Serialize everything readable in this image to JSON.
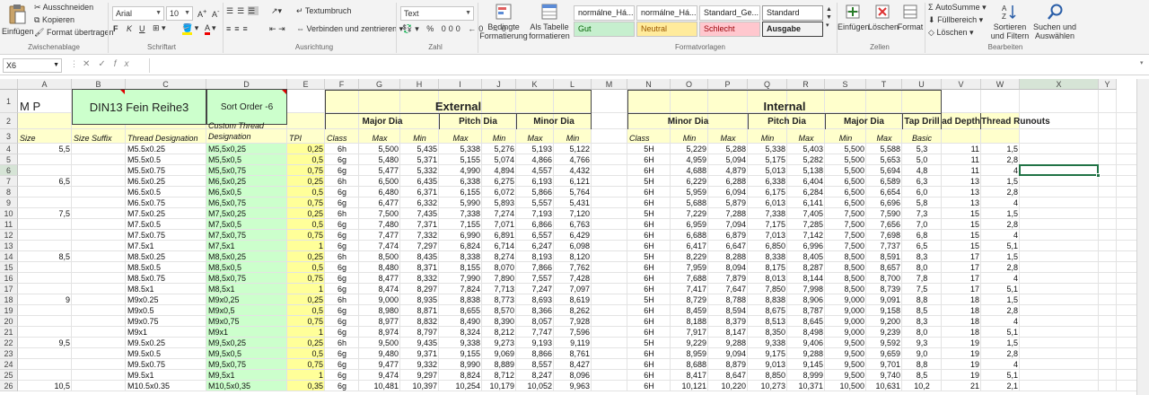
{
  "ribbon": {
    "clipboard": {
      "paste": "Einfügen",
      "cut": "Ausschneiden",
      "copy": "Kopieren",
      "format_painter": "Format übertragen",
      "group": "Zwischenablage"
    },
    "font": {
      "name": "Arial",
      "size": "10",
      "group": "Schriftart",
      "bold": "F",
      "italic": "K",
      "underline": "U"
    },
    "alignment": {
      "wrap": "Textumbruch",
      "merge": "Verbinden und zentrieren",
      "group": "Ausrichtung"
    },
    "number": {
      "format": "Text",
      "group": "Zahl"
    },
    "styles": {
      "conditional": "Bedingte Formatierung",
      "as_table": "Als Tabelle formatieren",
      "group": "Formatvorlagen",
      "cells": [
        "normálne_Há...",
        "normálne_Há...",
        "Standard_Ge...",
        "Standard",
        "Gut",
        "Neutral",
        "Schlecht",
        "Ausgabe"
      ]
    },
    "cells": {
      "insert": "Einfügen",
      "delete": "Löschen",
      "format": "Format",
      "group": "Zellen"
    },
    "editing": {
      "autosum": "AutoSumme",
      "fill": "Füllbereich",
      "clear": "Löschen",
      "sort": "Sortieren und Filtern",
      "find": "Suchen und Auswählen",
      "group": "Bearbeiten"
    }
  },
  "formula_bar": {
    "name_box": "X6",
    "content": ""
  },
  "columns": [
    "A",
    "B",
    "C",
    "D",
    "E",
    "F",
    "G",
    "H",
    "I",
    "J",
    "K",
    "L",
    "M",
    "N",
    "O",
    "P",
    "Q",
    "R",
    "S",
    "T",
    "U",
    "V",
    "W",
    "X",
    "Y"
  ],
  "header": {
    "mp": "M P",
    "title": "DIN13 Fein Reihe3",
    "sort": "Sort Order -6",
    "external": "External",
    "internal": "Internal",
    "major_dia": "Major Dia",
    "pitch_dia": "Pitch Dia",
    "minor_dia": "Minor Dia",
    "tap_drill": "Tap Drill",
    "thread_depth": "Thread Depth",
    "thread_runouts": "Thread Runouts",
    "custom": "Custom Thread Designation",
    "size": "Size",
    "size_suffix": "Size Suffix",
    "designation": "Thread Designation",
    "tpi": "TPI",
    "class": "Class",
    "max": "Max",
    "min": "Min",
    "basic": "Basic"
  },
  "rows": [
    {
      "n": "4",
      "a": "5,5",
      "c": "M5.5x0.25",
      "d": "M5,5x0,25",
      "e": "0,25",
      "f": "6h",
      "g": "5,500",
      "h": "5,435",
      "i": "5,338",
      "j": "5,276",
      "k": "5,193",
      "l": "5,122",
      "n2": "5H",
      "o": "5,229",
      "p": "5,288",
      "q": "5,338",
      "r": "5,403",
      "s": "5,500",
      "t": "5,588",
      "u": "5,3",
      "v": "11",
      "w": "1,5"
    },
    {
      "n": "5",
      "a": "",
      "c": "M5.5x0.5",
      "d": "M5,5x0,5",
      "e": "0,5",
      "f": "6g",
      "g": "5,480",
      "h": "5,371",
      "i": "5,155",
      "j": "5,074",
      "k": "4,866",
      "l": "4,766",
      "n2": "6H",
      "o": "4,959",
      "p": "5,094",
      "q": "5,175",
      "r": "5,282",
      "s": "5,500",
      "t": "5,653",
      "u": "5,0",
      "v": "11",
      "w": "2,8"
    },
    {
      "n": "6",
      "a": "",
      "c": "M5.5x0.75",
      "d": "M5,5x0,75",
      "e": "0,75",
      "f": "6g",
      "g": "5,477",
      "h": "5,332",
      "i": "4,990",
      "j": "4,894",
      "k": "4,557",
      "l": "4,432",
      "n2": "6H",
      "o": "4,688",
      "p": "4,879",
      "q": "5,013",
      "r": "5,138",
      "s": "5,500",
      "t": "5,694",
      "u": "4,8",
      "v": "11",
      "w": "4"
    },
    {
      "n": "7",
      "a": "6,5",
      "c": "M6.5x0.25",
      "d": "M6,5x0,25",
      "e": "0,25",
      "f": "6h",
      "g": "6,500",
      "h": "6,435",
      "i": "6,338",
      "j": "6,275",
      "k": "6,193",
      "l": "6,121",
      "n2": "5H",
      "o": "6,229",
      "p": "6,288",
      "q": "6,338",
      "r": "6,404",
      "s": "6,500",
      "t": "6,589",
      "u": "6,3",
      "v": "13",
      "w": "1,5"
    },
    {
      "n": "8",
      "a": "",
      "c": "M6.5x0.5",
      "d": "M6,5x0,5",
      "e": "0,5",
      "f": "6g",
      "g": "6,480",
      "h": "6,371",
      "i": "6,155",
      "j": "6,072",
      "k": "5,866",
      "l": "5,764",
      "n2": "6H",
      "o": "5,959",
      "p": "6,094",
      "q": "6,175",
      "r": "6,284",
      "s": "6,500",
      "t": "6,654",
      "u": "6,0",
      "v": "13",
      "w": "2,8"
    },
    {
      "n": "9",
      "a": "",
      "c": "M6.5x0.75",
      "d": "M6,5x0,75",
      "e": "0,75",
      "f": "6g",
      "g": "6,477",
      "h": "6,332",
      "i": "5,990",
      "j": "5,893",
      "k": "5,557",
      "l": "5,431",
      "n2": "6H",
      "o": "5,688",
      "p": "5,879",
      "q": "6,013",
      "r": "6,141",
      "s": "6,500",
      "t": "6,696",
      "u": "5,8",
      "v": "13",
      "w": "4"
    },
    {
      "n": "10",
      "a": "7,5",
      "c": "M7.5x0.25",
      "d": "M7,5x0,25",
      "e": "0,25",
      "f": "6h",
      "g": "7,500",
      "h": "7,435",
      "i": "7,338",
      "j": "7,274",
      "k": "7,193",
      "l": "7,120",
      "n2": "5H",
      "o": "7,229",
      "p": "7,288",
      "q": "7,338",
      "r": "7,405",
      "s": "7,500",
      "t": "7,590",
      "u": "7,3",
      "v": "15",
      "w": "1,5"
    },
    {
      "n": "11",
      "a": "",
      "c": "M7.5x0.5",
      "d": "M7,5x0,5",
      "e": "0,5",
      "f": "6g",
      "g": "7,480",
      "h": "7,371",
      "i": "7,155",
      "j": "7,071",
      "k": "6,866",
      "l": "6,763",
      "n2": "6H",
      "o": "6,959",
      "p": "7,094",
      "q": "7,175",
      "r": "7,285",
      "s": "7,500",
      "t": "7,656",
      "u": "7,0",
      "v": "15",
      "w": "2,8"
    },
    {
      "n": "12",
      "a": "",
      "c": "M7.5x0.75",
      "d": "M7,5x0,75",
      "e": "0,75",
      "f": "6g",
      "g": "7,477",
      "h": "7,332",
      "i": "6,990",
      "j": "6,891",
      "k": "6,557",
      "l": "6,429",
      "n2": "6H",
      "o": "6,688",
      "p": "6,879",
      "q": "7,013",
      "r": "7,142",
      "s": "7,500",
      "t": "7,698",
      "u": "6,8",
      "v": "15",
      "w": "4"
    },
    {
      "n": "13",
      "a": "",
      "c": "M7.5x1",
      "d": "M7,5x1",
      "e": "1",
      "f": "6g",
      "g": "7,474",
      "h": "7,297",
      "i": "6,824",
      "j": "6,714",
      "k": "6,247",
      "l": "6,098",
      "n2": "6H",
      "o": "6,417",
      "p": "6,647",
      "q": "6,850",
      "r": "6,996",
      "s": "7,500",
      "t": "7,737",
      "u": "6,5",
      "v": "15",
      "w": "5,1"
    },
    {
      "n": "14",
      "a": "8,5",
      "c": "M8.5x0.25",
      "d": "M8,5x0,25",
      "e": "0,25",
      "f": "6h",
      "g": "8,500",
      "h": "8,435",
      "i": "8,338",
      "j": "8,274",
      "k": "8,193",
      "l": "8,120",
      "n2": "5H",
      "o": "8,229",
      "p": "8,288",
      "q": "8,338",
      "r": "8,405",
      "s": "8,500",
      "t": "8,591",
      "u": "8,3",
      "v": "17",
      "w": "1,5"
    },
    {
      "n": "15",
      "a": "",
      "c": "M8.5x0.5",
      "d": "M8,5x0,5",
      "e": "0,5",
      "f": "6g",
      "g": "8,480",
      "h": "8,371",
      "i": "8,155",
      "j": "8,070",
      "k": "7,866",
      "l": "7,762",
      "n2": "6H",
      "o": "7,959",
      "p": "8,094",
      "q": "8,175",
      "r": "8,287",
      "s": "8,500",
      "t": "8,657",
      "u": "8,0",
      "v": "17",
      "w": "2,8"
    },
    {
      "n": "16",
      "a": "",
      "c": "M8.5x0.75",
      "d": "M8,5x0,75",
      "e": "0,75",
      "f": "6g",
      "g": "8,477",
      "h": "8,332",
      "i": "7,990",
      "j": "7,890",
      "k": "7,557",
      "l": "7,428",
      "n2": "6H",
      "o": "7,688",
      "p": "7,879",
      "q": "8,013",
      "r": "8,144",
      "s": "8,500",
      "t": "8,700",
      "u": "7,8",
      "v": "17",
      "w": "4"
    },
    {
      "n": "17",
      "a": "",
      "c": "M8.5x1",
      "d": "M8,5x1",
      "e": "1",
      "f": "6g",
      "g": "8,474",
      "h": "8,297",
      "i": "7,824",
      "j": "7,713",
      "k": "7,247",
      "l": "7,097",
      "n2": "6H",
      "o": "7,417",
      "p": "7,647",
      "q": "7,850",
      "r": "7,998",
      "s": "8,500",
      "t": "8,739",
      "u": "7,5",
      "v": "17",
      "w": "5,1"
    },
    {
      "n": "18",
      "a": "9",
      "c": "M9x0.25",
      "d": "M9x0,25",
      "e": "0,25",
      "f": "6h",
      "g": "9,000",
      "h": "8,935",
      "i": "8,838",
      "j": "8,773",
      "k": "8,693",
      "l": "8,619",
      "n2": "5H",
      "o": "8,729",
      "p": "8,788",
      "q": "8,838",
      "r": "8,906",
      "s": "9,000",
      "t": "9,091",
      "u": "8,8",
      "v": "18",
      "w": "1,5"
    },
    {
      "n": "19",
      "a": "",
      "c": "M9x0.5",
      "d": "M9x0,5",
      "e": "0,5",
      "f": "6g",
      "g": "8,980",
      "h": "8,871",
      "i": "8,655",
      "j": "8,570",
      "k": "8,366",
      "l": "8,262",
      "n2": "6H",
      "o": "8,459",
      "p": "8,594",
      "q": "8,675",
      "r": "8,787",
      "s": "9,000",
      "t": "9,158",
      "u": "8,5",
      "v": "18",
      "w": "2,8"
    },
    {
      "n": "20",
      "a": "",
      "c": "M9x0.75",
      "d": "M9x0,75",
      "e": "0,75",
      "f": "6g",
      "g": "8,977",
      "h": "8,832",
      "i": "8,490",
      "j": "8,390",
      "k": "8,057",
      "l": "7,928",
      "n2": "6H",
      "o": "8,188",
      "p": "8,379",
      "q": "8,513",
      "r": "8,645",
      "s": "9,000",
      "t": "9,200",
      "u": "8,3",
      "v": "18",
      "w": "4"
    },
    {
      "n": "21",
      "a": "",
      "c": "M9x1",
      "d": "M9x1",
      "e": "1",
      "f": "6g",
      "g": "8,974",
      "h": "8,797",
      "i": "8,324",
      "j": "8,212",
      "k": "7,747",
      "l": "7,596",
      "n2": "6H",
      "o": "7,917",
      "p": "8,147",
      "q": "8,350",
      "r": "8,498",
      "s": "9,000",
      "t": "9,239",
      "u": "8,0",
      "v": "18",
      "w": "5,1"
    },
    {
      "n": "22",
      "a": "9,5",
      "c": "M9.5x0.25",
      "d": "M9,5x0,25",
      "e": "0,25",
      "f": "6h",
      "g": "9,500",
      "h": "9,435",
      "i": "9,338",
      "j": "9,273",
      "k": "9,193",
      "l": "9,119",
      "n2": "5H",
      "o": "9,229",
      "p": "9,288",
      "q": "9,338",
      "r": "9,406",
      "s": "9,500",
      "t": "9,592",
      "u": "9,3",
      "v": "19",
      "w": "1,5"
    },
    {
      "n": "23",
      "a": "",
      "c": "M9.5x0.5",
      "d": "M9,5x0,5",
      "e": "0,5",
      "f": "6g",
      "g": "9,480",
      "h": "9,371",
      "i": "9,155",
      "j": "9,069",
      "k": "8,866",
      "l": "8,761",
      "n2": "6H",
      "o": "8,959",
      "p": "9,094",
      "q": "9,175",
      "r": "9,288",
      "s": "9,500",
      "t": "9,659",
      "u": "9,0",
      "v": "19",
      "w": "2,8"
    },
    {
      "n": "24",
      "a": "",
      "c": "M9.5x0.75",
      "d": "M9,5x0,75",
      "e": "0,75",
      "f": "6g",
      "g": "9,477",
      "h": "9,332",
      "i": "8,990",
      "j": "8,889",
      "k": "8,557",
      "l": "8,427",
      "n2": "6H",
      "o": "8,688",
      "p": "8,879",
      "q": "9,013",
      "r": "9,145",
      "s": "9,500",
      "t": "9,701",
      "u": "8,8",
      "v": "19",
      "w": "4"
    },
    {
      "n": "25",
      "a": "",
      "c": "M9.5x1",
      "d": "M9,5x1",
      "e": "1",
      "f": "6g",
      "g": "9,474",
      "h": "9,297",
      "i": "8,824",
      "j": "8,712",
      "k": "8,247",
      "l": "8,096",
      "n2": "6H",
      "o": "8,417",
      "p": "8,647",
      "q": "8,850",
      "r": "8,999",
      "s": "9,500",
      "t": "9,740",
      "u": "8,5",
      "v": "19",
      "w": "5,1"
    },
    {
      "n": "26",
      "a": "10,5",
      "c": "M10.5x0.35",
      "d": "M10,5x0,35",
      "e": "0,35",
      "f": "6g",
      "g": "10,481",
      "h": "10,397",
      "i": "10,254",
      "j": "10,179",
      "k": "10,052",
      "l": "9,963",
      "n2": "6H",
      "o": "10,121",
      "p": "10,220",
      "q": "10,273",
      "r": "10,371",
      "s": "10,500",
      "t": "10,631",
      "u": "10,2",
      "v": "21",
      "w": "2,1"
    }
  ]
}
